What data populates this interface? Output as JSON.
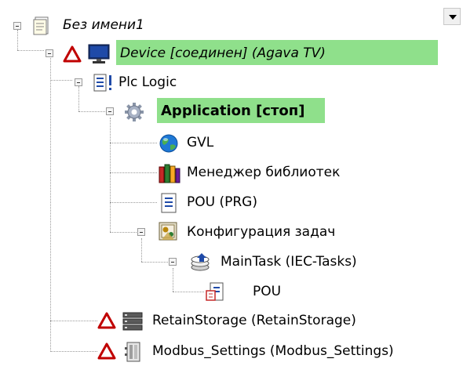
{
  "tree": {
    "root": {
      "label": "Без имени1"
    },
    "device": {
      "label": "Device [соединен] (Agava TV)"
    },
    "plc_logic": {
      "label": "Plc Logic"
    },
    "application": {
      "label": "Application [стоп]"
    },
    "gvl": {
      "label": "GVL"
    },
    "library_manager": {
      "label": "Менеджер библиотек"
    },
    "pou_prg": {
      "label": "POU (PRG)"
    },
    "task_config": {
      "label": "Конфигурация задач"
    },
    "main_task": {
      "label": "MainTask (IEC-Tasks)"
    },
    "task_pou": {
      "label": "POU"
    },
    "retain_storage": {
      "label": "RetainStorage (RetainStorage)"
    },
    "modbus_settings": {
      "label": "Modbus_Settings (Modbus_Settings)"
    }
  },
  "colors": {
    "highlight": "#8fe08b",
    "warning": "#c00000",
    "tree_line": "#9a9a9a"
  },
  "icons": {
    "root": "project-file-icon",
    "device": "monitor-icon",
    "plc_logic": "plc-logic-icon",
    "application": "gear-icon",
    "gvl": "globe-icon",
    "library_manager": "books-icon",
    "pou_prg": "document-icon",
    "task_config": "task-config-icon",
    "main_task": "task-stack-icon",
    "task_pou": "pou-call-icon",
    "retain_storage": "storage-icon",
    "modbus_settings": "modbus-module-icon",
    "warning": "warning-triangle-icon",
    "dropdown": "dropdown-arrow-icon"
  }
}
